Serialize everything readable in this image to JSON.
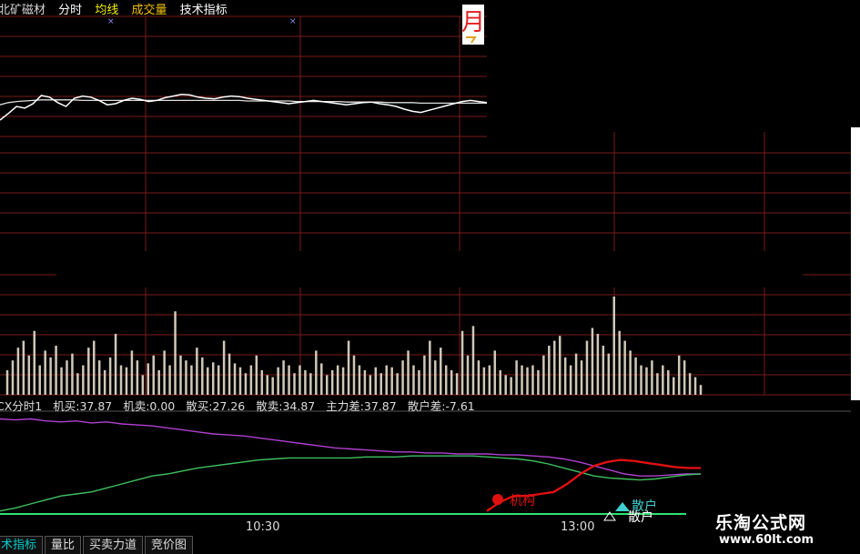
{
  "header": {
    "stock_name": "北矿磁材",
    "mode": "分时",
    "avg_line": "均线",
    "volume": "成交量",
    "indicator": "技术指标"
  },
  "colors": {
    "grid": "#7a1a1a",
    "price": "#ffffff",
    "avg": "#dddddd",
    "volume": "#cfc8b8",
    "purple": "#b040d0",
    "green": "#40c060",
    "red": "#e01010",
    "baseline": "#30e070",
    "header_stock": "#d8d8d8",
    "header_mode": "#ffffff",
    "header_avg": "#f0f000",
    "header_vol": "#f0c000",
    "header_ind": "#ffffff"
  },
  "indicator_bar": {
    "name": "CX分时1",
    "jimai": "机买:37.87",
    "jimai_sell": "机卖:0.00",
    "sanmai": "散买:27.26",
    "sanmai_sell": "散卖:34.87",
    "zhuli": "主力差:37.87",
    "sanhu": "散户差:-7.61"
  },
  "labels": {
    "jigou": "机构",
    "sanhu": "散户",
    "sanhu_shadow": "散户"
  },
  "time_labels": [
    "10:30",
    "13:00"
  ],
  "tabs": [
    "术指标",
    "量比",
    "买卖力道",
    "竞价图"
  ],
  "logo": {
    "line1": "乐淘公式网",
    "line2": "www.60lt.com"
  },
  "chart_data": {
    "type": "line",
    "price": [
      0.3,
      0.42,
      0.55,
      0.52,
      0.6,
      0.75,
      0.72,
      0.62,
      0.55,
      0.7,
      0.74,
      0.72,
      0.66,
      0.58,
      0.6,
      0.66,
      0.7,
      0.68,
      0.64,
      0.66,
      0.71,
      0.74,
      0.77,
      0.76,
      0.72,
      0.7,
      0.69,
      0.72,
      0.74,
      0.73,
      0.7,
      0.68,
      0.66,
      0.64,
      0.62,
      0.6,
      0.62,
      0.64,
      0.66,
      0.64,
      0.62,
      0.6,
      0.58,
      0.6,
      0.62,
      0.63,
      0.6,
      0.58,
      0.55,
      0.5,
      0.46,
      0.44,
      0.48,
      0.52,
      0.56,
      0.6,
      0.64,
      0.66,
      0.64,
      0.62
    ],
    "avg": [
      0.58,
      0.62,
      0.64,
      0.65,
      0.66,
      0.67,
      0.67,
      0.67,
      0.67,
      0.67,
      0.66,
      0.66,
      0.66,
      0.66,
      0.66,
      0.66,
      0.66,
      0.66,
      0.66,
      0.66,
      0.66,
      0.66,
      0.66,
      0.66,
      0.66,
      0.66,
      0.66,
      0.66,
      0.66,
      0.66,
      0.65,
      0.65,
      0.65,
      0.65,
      0.65,
      0.65,
      0.64,
      0.64,
      0.64,
      0.64,
      0.64,
      0.64,
      0.63,
      0.63,
      0.63,
      0.63,
      0.63,
      0.62,
      0.62,
      0.62,
      0.62,
      0.61,
      0.61,
      0.61,
      0.61,
      0.61,
      0.61,
      0.61,
      0.61,
      0.61
    ],
    "volume": [
      0.25,
      0.35,
      0.48,
      0.55,
      0.4,
      0.65,
      0.3,
      0.45,
      0.38,
      0.5,
      0.28,
      0.35,
      0.42,
      0.22,
      0.3,
      0.48,
      0.55,
      0.35,
      0.25,
      0.38,
      0.62,
      0.3,
      0.28,
      0.45,
      0.35,
      0.2,
      0.32,
      0.4,
      0.25,
      0.45,
      0.3,
      0.85,
      0.4,
      0.35,
      0.3,
      0.48,
      0.38,
      0.28,
      0.33,
      0.3,
      0.55,
      0.42,
      0.32,
      0.28,
      0.22,
      0.3,
      0.4,
      0.25,
      0.2,
      0.18,
      0.28,
      0.35,
      0.3,
      0.22,
      0.3,
      0.25,
      0.22,
      0.45,
      0.32,
      0.2,
      0.25,
      0.3,
      0.28,
      0.55,
      0.4,
      0.3,
      0.25,
      0.2,
      0.28,
      0.22,
      0.3,
      0.28,
      0.22,
      0.35,
      0.45,
      0.3,
      0.25,
      0.4,
      0.55,
      0.35,
      0.48,
      0.3,
      0.25,
      0.22,
      0.65,
      0.4,
      0.7,
      0.35,
      0.28,
      0.3,
      0.45,
      0.25,
      0.2,
      0.18,
      0.35,
      0.3,
      0.28,
      0.3,
      0.25,
      0.4,
      0.5,
      0.55,
      0.6,
      0.38,
      0.3,
      0.42,
      0.35,
      0.55,
      0.68,
      0.62,
      0.5,
      0.42,
      1.0,
      0.65,
      0.55,
      0.45,
      0.38,
      0.3,
      0.28,
      0.35,
      0.22,
      0.3,
      0.25,
      0.18,
      0.4,
      0.35,
      0.22,
      0.18,
      0.1
    ],
    "purple": [
      0.95,
      0.94,
      0.95,
      0.93,
      0.92,
      0.93,
      0.91,
      0.92,
      0.9,
      0.89,
      0.88,
      0.86,
      0.84,
      0.82,
      0.8,
      0.79,
      0.78,
      0.76,
      0.74,
      0.72,
      0.7,
      0.68,
      0.66,
      0.65,
      0.64,
      0.63,
      0.62,
      0.62,
      0.61,
      0.61,
      0.6,
      0.6,
      0.6,
      0.59,
      0.59,
      0.58,
      0.57,
      0.55,
      0.52,
      0.48,
      0.44,
      0.4,
      0.38,
      0.38,
      0.39,
      0.4,
      0.4
    ],
    "green": [
      0.03,
      0.06,
      0.1,
      0.14,
      0.18,
      0.2,
      0.22,
      0.26,
      0.3,
      0.34,
      0.38,
      0.4,
      0.43,
      0.46,
      0.48,
      0.5,
      0.52,
      0.54,
      0.55,
      0.56,
      0.56,
      0.56,
      0.56,
      0.56,
      0.57,
      0.57,
      0.57,
      0.58,
      0.58,
      0.58,
      0.58,
      0.58,
      0.57,
      0.56,
      0.55,
      0.53,
      0.5,
      0.46,
      0.42,
      0.38,
      0.36,
      0.35,
      0.34,
      0.35,
      0.37,
      0.39,
      0.4
    ],
    "red": [
      0.03,
      0.12,
      0.18,
      0.18,
      0.2,
      0.22,
      0.3,
      0.4,
      0.48,
      0.52,
      0.54,
      0.53,
      0.51,
      0.49,
      0.47,
      0.46,
      0.46
    ]
  }
}
